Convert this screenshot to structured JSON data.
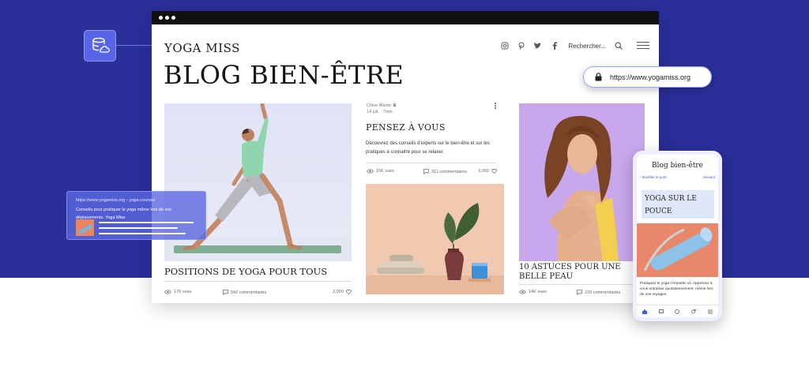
{
  "site": {
    "name": "YOGA MISS",
    "blog_title": "BLOG BIEN-ÊTRE",
    "search_label": "Rechercher...",
    "social_icons": [
      "instagram-icon",
      "pinterest-icon",
      "twitter-icon",
      "facebook-icon"
    ],
    "url": "https://www.yogamiss.org"
  },
  "colors": {
    "background_band": "#2a2f9a",
    "accent_blue": "#5865e8",
    "mat_green": "#7fae92",
    "vase_background": "#f0c9b0",
    "portrait_background": "#c9a7ec",
    "phone_image_background": "#e8876a"
  },
  "posts": [
    {
      "title": "POSITIONS DE YOGA POUR TOUS",
      "views": "176 vues",
      "comments": "542 commentaires",
      "likes": "2,000"
    },
    {
      "author": "Chloe Martin",
      "date": "14 juil. · 7min",
      "title": "PENSEZ À VOUS",
      "excerpt": "Découvrez des conseils d'experts sur le bien-être et sur les pratiques à connaitre pour se relaxer.",
      "views": "15K vues",
      "comments": "311 commentaires",
      "likes": "3,000"
    },
    {
      "title": "10 ASTUCES POUR UNE BELLE PEAU",
      "views": "14K vues",
      "comments": "220 commentaires"
    }
  ],
  "seo_snippet": {
    "url": "https://www.yogamiss.org › yoga-courses",
    "description": "Conseils pour pratiquer le yoga même lors de vos déplacements. Yoga Miss"
  },
  "phone": {
    "title": "Blog bien-être",
    "back_label": "Modifier le post",
    "next_label": "Suivant",
    "post_title": "YOGA SUR LE POUCE",
    "text": "Pratiquez le yoga n'importe où. Apprenez à vous entraîner quotidiennement, même lors de vos voyages."
  }
}
